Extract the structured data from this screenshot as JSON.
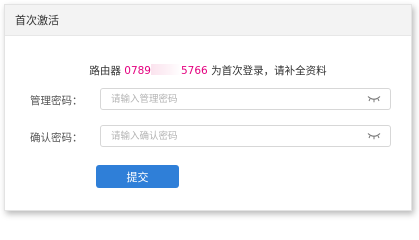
{
  "dialog": {
    "title": "首次激活"
  },
  "notice": {
    "prefix": "路由器 ",
    "serial_start": "0789",
    "serial_end": "5766",
    "suffix": " 为首次登录，请补全资料"
  },
  "form": {
    "admin_password": {
      "label": "管理密码：",
      "placeholder": "请输入管理密码",
      "value": ""
    },
    "confirm_password": {
      "label": "确认密码：",
      "placeholder": "请输入确认密码",
      "value": ""
    },
    "toggle_icon": "eye-closed-icon"
  },
  "submit_label": "提交",
  "colors": {
    "serial": "#e4007f",
    "primary_button": "#2f7fd8",
    "header_bg": "#f3f3f3"
  }
}
